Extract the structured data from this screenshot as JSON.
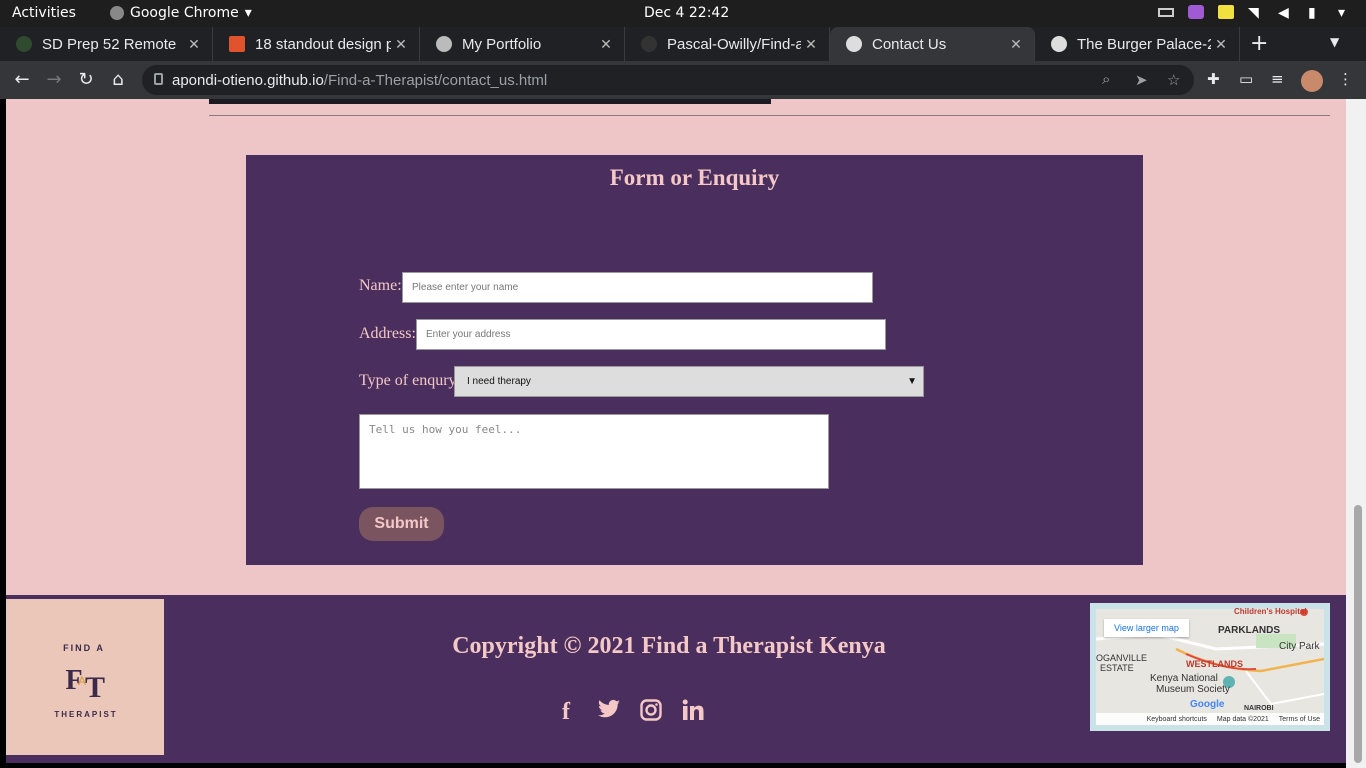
{
  "system": {
    "activities": "Activities",
    "app_name": "Google Chrome",
    "clock": "Dec 4  22:42"
  },
  "tabs": [
    {
      "title": "SD Prep 52 Remote"
    },
    {
      "title": "18 standout design p"
    },
    {
      "title": "My Portfolio"
    },
    {
      "title": "Pascal-Owilly/Find-a"
    },
    {
      "title": "Contact Us"
    },
    {
      "title": "The Burger Palace-2"
    }
  ],
  "address": {
    "host": "apondi-otieno.github.io",
    "path": "/Find-a-Therapist/contact_us.html"
  },
  "form": {
    "heading": "Form or Enquiry",
    "name_label": "Name:",
    "name_placeholder": "Please enter your name",
    "address_label": "Address:",
    "address_placeholder": "Enter your address",
    "type_label": "Type of enqury",
    "type_selected": "I need therapy",
    "message_placeholder": "Tell us how you feel...",
    "submit_label": "Submit"
  },
  "footer": {
    "copyright": "Copyright © 2021 Find a Therapist Kenya",
    "logo_top": "FIND A",
    "logo_bottom": "THERAPIST",
    "socials": [
      "facebook-icon",
      "twitter-icon",
      "instagram-icon",
      "linkedin-icon"
    ],
    "map": {
      "view_larger": "View larger map",
      "labels": [
        "Children's Hospital",
        "PARKLANDS",
        "City Park",
        "OGANVILLE",
        "ESTATE",
        "WESTLANDS",
        "Kenya National",
        "Museum Society",
        "Google",
        "NAIROBI"
      ],
      "footer_links": [
        "Keyboard shortcuts",
        "Map data ©2021",
        "Terms of Use"
      ]
    }
  }
}
